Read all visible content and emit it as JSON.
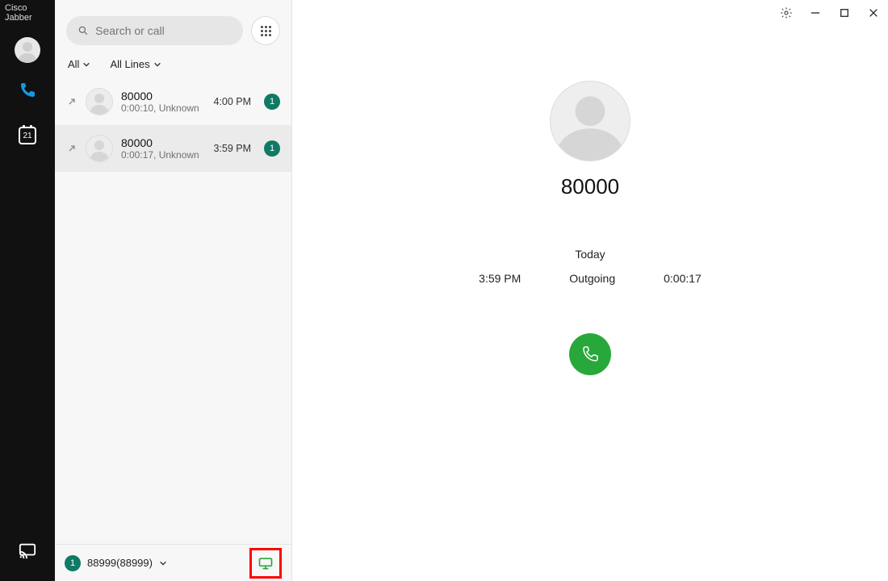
{
  "app_title": "Cisco Jabber",
  "calendar_day": "21",
  "search": {
    "placeholder": "Search or call"
  },
  "filters": {
    "scope": "All",
    "lines": "All Lines"
  },
  "calls": [
    {
      "name": "80000",
      "sub": "0:00:10, Unknown",
      "time": "4:00 PM",
      "badge": "1"
    },
    {
      "name": "80000",
      "sub": "0:00:17, Unknown",
      "time": "3:59 PM",
      "badge": "1"
    }
  ],
  "footer": {
    "badge": "1",
    "line": "88999(88999)"
  },
  "detail": {
    "name": "80000",
    "section": "Today",
    "time": "3:59 PM",
    "direction": "Outgoing",
    "duration": "0:00:17"
  },
  "colors": {
    "accent": "#0f7a66",
    "call_green": "#28a83a",
    "phone_blue": "#1498e3"
  }
}
